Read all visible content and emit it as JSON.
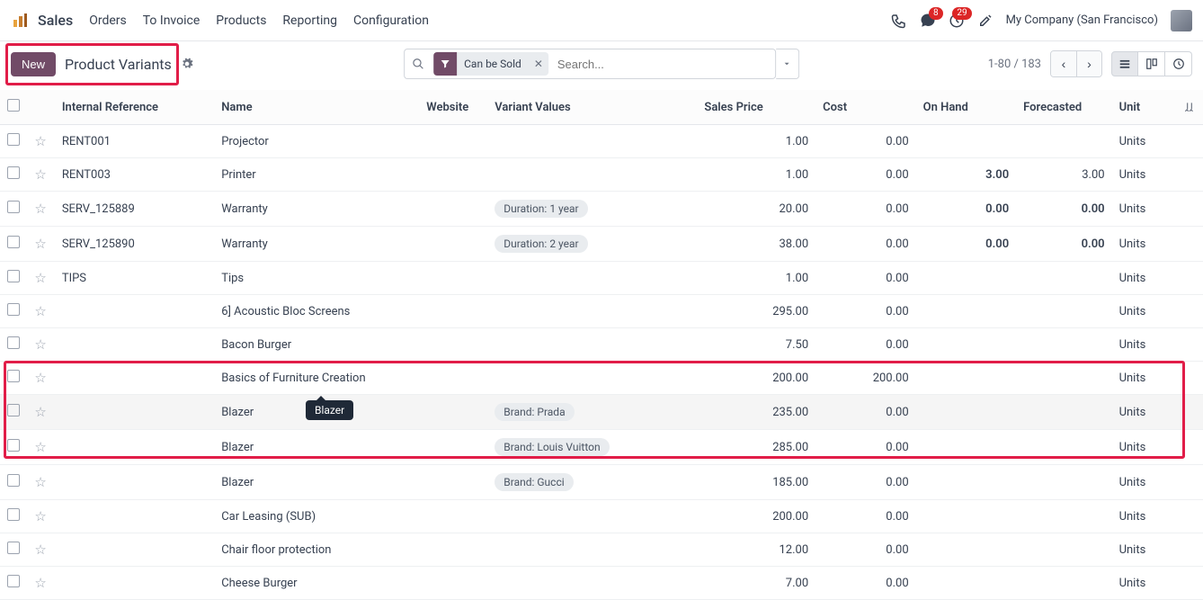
{
  "nav": {
    "brand": "Sales",
    "links": [
      "Orders",
      "To Invoice",
      "Products",
      "Reporting",
      "Configuration"
    ],
    "messages_badge": "8",
    "activities_badge": "29",
    "company": "My Company (San Francisco)"
  },
  "controls": {
    "new_label": "New",
    "breadcrumb": "Product Variants",
    "filter_chip": "Can be Sold",
    "search_placeholder": "Search...",
    "pager": "1-80 / 183"
  },
  "columns": {
    "ref": "Internal Reference",
    "name": "Name",
    "website": "Website",
    "variant": "Variant Values",
    "price": "Sales Price",
    "cost": "Cost",
    "onhand": "On Hand",
    "forecast": "Forecasted",
    "unit": "Unit"
  },
  "rows": [
    {
      "ref": "RENT001",
      "name": "Projector",
      "variant": "",
      "price": "1.00",
      "cost": "0.00",
      "onhand": "",
      "forecast": "",
      "unit": "Units"
    },
    {
      "ref": "RENT003",
      "name": "Printer",
      "variant": "",
      "price": "1.00",
      "cost": "0.00",
      "onhand": "3.00",
      "onhand_bold": true,
      "forecast": "3.00",
      "unit": "Units"
    },
    {
      "ref": "SERV_125889",
      "name": "Warranty",
      "variant": "Duration: 1 year",
      "price": "20.00",
      "cost": "0.00",
      "onhand": "0.00",
      "onhand_orange": true,
      "forecast": "0.00",
      "forecast_orange": true,
      "unit": "Units"
    },
    {
      "ref": "SERV_125890",
      "name": "Warranty",
      "variant": "Duration: 2 year",
      "price": "38.00",
      "cost": "0.00",
      "onhand": "0.00",
      "onhand_orange": true,
      "forecast": "0.00",
      "forecast_orange": true,
      "unit": "Units"
    },
    {
      "ref": "TIPS",
      "name": "Tips",
      "variant": "",
      "price": "1.00",
      "cost": "0.00",
      "onhand": "",
      "forecast": "",
      "unit": "Units"
    },
    {
      "ref": "",
      "name": "6] Acoustic Bloc Screens",
      "variant": "",
      "price": "295.00",
      "cost": "0.00",
      "onhand": "",
      "forecast": "",
      "unit": "Units"
    },
    {
      "ref": "",
      "name": "Bacon Burger",
      "variant": "",
      "price": "7.50",
      "cost": "0.00",
      "onhand": "",
      "forecast": "",
      "unit": "Units"
    },
    {
      "ref": "",
      "name": "Basics of Furniture Creation",
      "variant": "",
      "price": "200.00",
      "cost": "200.00",
      "onhand": "",
      "forecast": "",
      "unit": "Units"
    },
    {
      "ref": "",
      "name": "Blazer",
      "variant": "Brand: Prada",
      "price": "235.00",
      "cost": "0.00",
      "onhand": "",
      "forecast": "",
      "unit": "Units",
      "hover": true
    },
    {
      "ref": "",
      "name": "Blazer",
      "variant": "Brand: Louis Vuitton",
      "price": "285.00",
      "cost": "0.00",
      "onhand": "",
      "forecast": "",
      "unit": "Units"
    },
    {
      "ref": "",
      "name": "Blazer",
      "variant": "Brand: Gucci",
      "price": "185.00",
      "cost": "0.00",
      "onhand": "",
      "forecast": "",
      "unit": "Units"
    },
    {
      "ref": "",
      "name": "Car Leasing (SUB)",
      "variant": "",
      "price": "200.00",
      "cost": "0.00",
      "onhand": "",
      "forecast": "",
      "unit": "Units"
    },
    {
      "ref": "",
      "name": "Chair floor protection",
      "variant": "",
      "price": "12.00",
      "cost": "0.00",
      "onhand": "",
      "forecast": "",
      "unit": "Units"
    },
    {
      "ref": "",
      "name": "Cheese Burger",
      "variant": "",
      "price": "7.00",
      "cost": "0.00",
      "onhand": "",
      "forecast": "",
      "unit": "Units"
    }
  ],
  "tooltip": "Blazer"
}
